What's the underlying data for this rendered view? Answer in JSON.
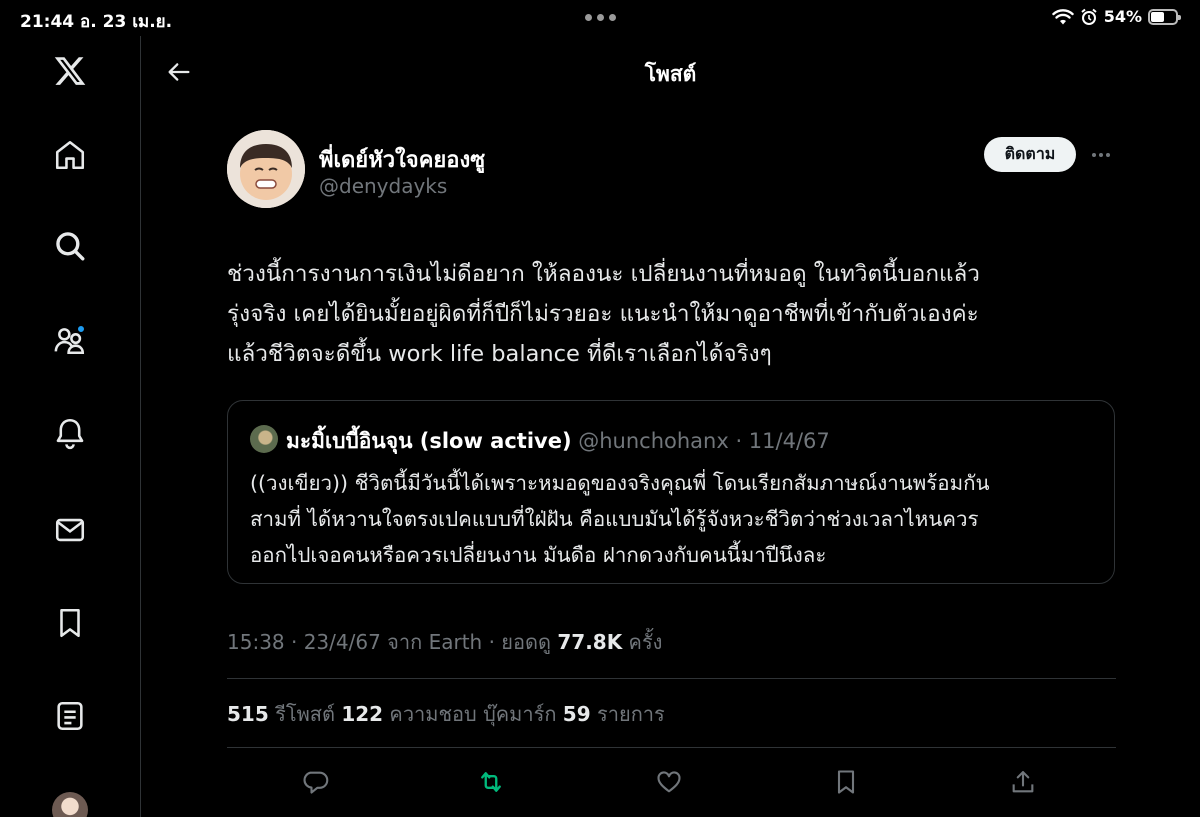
{
  "statusbar": {
    "time_date": "21:44  อ. 23 เม.ย.",
    "battery": "54%",
    "battery_level": 0.54
  },
  "sidebar": {
    "items": [
      {
        "name": "x-logo"
      },
      {
        "name": "home"
      },
      {
        "name": "search"
      },
      {
        "name": "communities",
        "notification": true
      },
      {
        "name": "notifications"
      },
      {
        "name": "messages"
      },
      {
        "name": "bookmarks"
      },
      {
        "name": "lists"
      },
      {
        "name": "profile"
      }
    ]
  },
  "header": {
    "title": "โพสต์"
  },
  "post": {
    "author_name": "พี่เดย์หัวใจคยองซู",
    "author_handle": "@denydayks",
    "follow_label": "ติดตาม",
    "text_lines": [
      "ช่วงนี้การงานการเงินไม่ดีอยาก ให้ลองนะ เปลี่ยนงานที่หมอดู ในทวิตนี้บอกแล้ว",
      "รุ่งจริง  เคยได้ยินมั้ยอยู่ผิดที่ก็ปีก็ไม่รวยอะ แนะนำให้มาดูอาชีพที่เข้ากับตัวเองค่ะ",
      "แล้วชีวิตจะดีขึ้น work life balance ที่ดีเราเลือกได้จริงๆ"
    ],
    "quote": {
      "name": "มะมิ้เบบี้อินจุน (slow active)",
      "handle_date": " @hunchohanx · 11/4/67",
      "text_lines": [
        "((วงเขียว)) ชีวิตนี้มีวันนี้ได้เพราะหมอดูของจริงคุณพี่  โดนเรียกสัมภาษณ์งานพร้อมกัน",
        "สามที่ ได้หวานใจตรงเปคแบบที่ใฝ่ฝัน คือแบบมันได้รู้จังหวะชีวิตว่าช่วงเวลาไหนควร",
        "ออกไปเจอคนหรือควรเปลี่ยนงาน มันดือ ฝากดวงกับคนนี้มาปีนึงละ"
      ]
    },
    "meta": {
      "prefix": "15:38 · 23/4/67 จาก Earth · ยอดดู ",
      "views": "77.8K",
      "suffix": " ครั้ง"
    },
    "stats": {
      "reposts_count": "515",
      "reposts_label": " รีโพสต์  ",
      "likes_count": "122",
      "likes_label": " ความชอบ  บุ๊คมาร์ก ",
      "bookmarks_count": "59",
      "bookmarks_label": " รายการ"
    }
  },
  "colors": {
    "background": "#000000",
    "text": "#e7e9ea",
    "muted": "#71767b",
    "border": "#2f3336",
    "accent": "#1d9bf0",
    "retweet_active": "#00ba7c"
  }
}
